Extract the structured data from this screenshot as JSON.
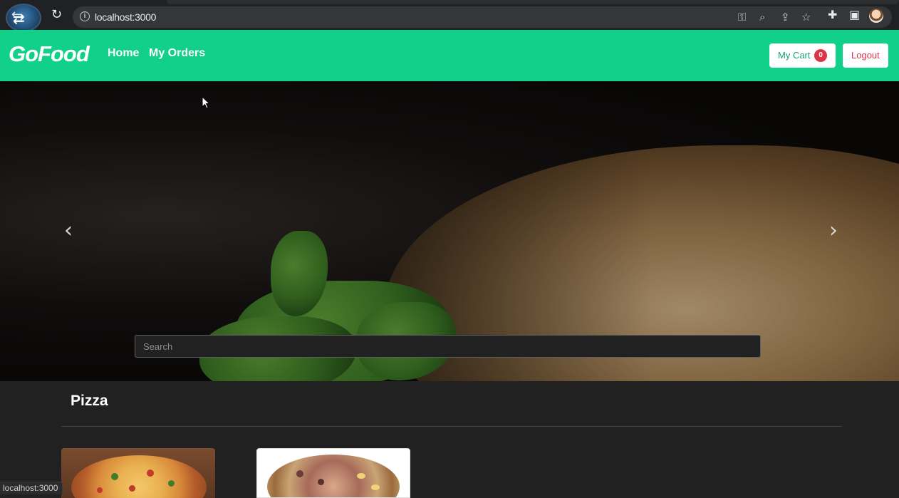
{
  "browser": {
    "url": "localhost:3000",
    "status_url": "localhost:3000",
    "icons": [
      "back-icon",
      "reload-icon",
      "info-icon",
      "key-icon",
      "zoom-icon",
      "share-icon",
      "star-icon",
      "extensions-icon",
      "side-panel-icon",
      "profile-avatar",
      "menu-icon"
    ]
  },
  "navbar": {
    "brand": "GoFood",
    "links": [
      {
        "label": "Home"
      },
      {
        "label": "My Orders"
      }
    ],
    "cart_label": "My Cart",
    "cart_count": "0",
    "logout_label": "Logout",
    "bg_color": "#11d08a",
    "badge_color": "#dc3545"
  },
  "hero": {
    "search_placeholder": "Search",
    "prev_icon": "chevron-left-icon",
    "next_icon": "chevron-right-icon"
  },
  "menu": {
    "category": "Pizza",
    "items": [
      {
        "image": "pizza-image"
      },
      {
        "image": "pizza-image"
      }
    ]
  }
}
